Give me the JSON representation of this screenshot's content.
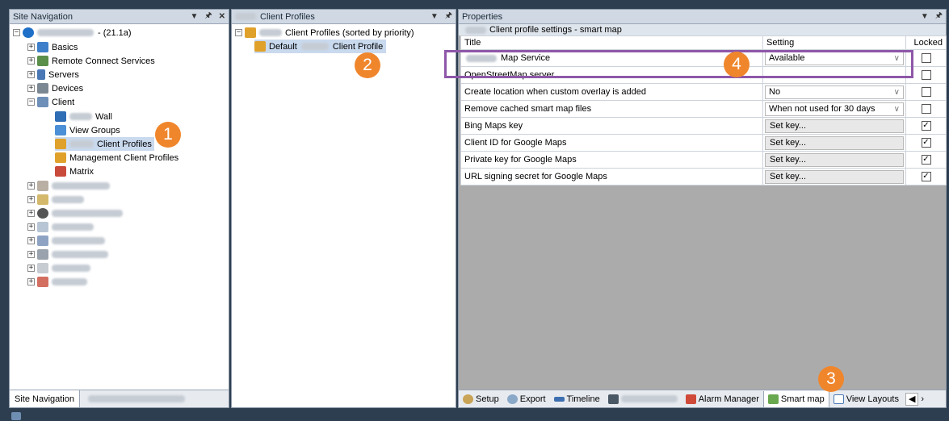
{
  "site_nav": {
    "title": "Site Navigation",
    "pin": "↓  $",
    "root_suffix": "- (21.1a)",
    "items": [
      {
        "label": "Basics"
      },
      {
        "label": "Remote Connect Services"
      },
      {
        "label": "Servers"
      },
      {
        "label": "Devices"
      },
      {
        "label": "Client"
      }
    ],
    "client_children": [
      {
        "label": "Wall"
      },
      {
        "label": "View Groups"
      },
      {
        "label": "Client Profiles"
      },
      {
        "label": "Management Client Profiles"
      },
      {
        "label": "Matrix"
      }
    ],
    "bottom_tab": "Site Navigation"
  },
  "client_profiles": {
    "title": "Client Profiles",
    "root_label": "Client Profiles (sorted by priority)",
    "default_prefix": "Default",
    "default_suffix": "Client Profile"
  },
  "properties": {
    "title": "Properties",
    "section": "Client profile settings - smart map",
    "headers": {
      "title": "Title",
      "setting": "Setting",
      "locked": "Locked"
    },
    "rows": [
      {
        "title": "Map Service",
        "setting": "Available",
        "kind": "dropdown",
        "locked": false
      },
      {
        "title": "OpenStreetMap server",
        "setting": "",
        "kind": "text",
        "locked": false
      },
      {
        "title": "Create location when custom overlay is added",
        "setting": "No",
        "kind": "dropdown",
        "locked": false
      },
      {
        "title": "Remove cached smart map files",
        "setting": "When not used for 30 days",
        "kind": "dropdown",
        "locked": false
      },
      {
        "title": "Bing Maps key",
        "setting": "Set key...",
        "kind": "button",
        "locked": true
      },
      {
        "title": "Client ID for Google Maps",
        "setting": "Set key...",
        "kind": "button",
        "locked": true
      },
      {
        "title": "Private key for Google Maps",
        "setting": "Set key...",
        "kind": "button",
        "locked": true
      },
      {
        "title": "URL signing secret for Google Maps",
        "setting": "Set key...",
        "kind": "button",
        "locked": true
      }
    ],
    "tabs": [
      {
        "label": "Setup"
      },
      {
        "label": "Export"
      },
      {
        "label": "Timeline"
      },
      {
        "label": "Alarm Manager"
      },
      {
        "label": "Smart map"
      },
      {
        "label": "View Layouts"
      }
    ]
  },
  "badges": [
    "1",
    "2",
    "3",
    "4"
  ],
  "colors": {
    "badge": "#f0862c",
    "highlight_box": "#8e57a8",
    "selection": "#c9d9ee"
  }
}
